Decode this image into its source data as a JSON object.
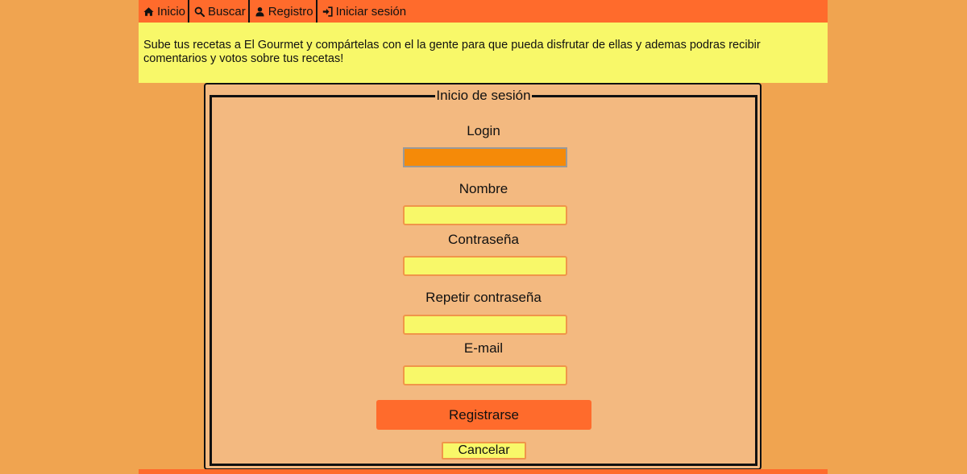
{
  "nav": {
    "items": [
      {
        "label": "Inicio",
        "icon": "home-icon"
      },
      {
        "label": "Buscar",
        "icon": "search-icon"
      },
      {
        "label": "Registro",
        "icon": "user-icon"
      },
      {
        "label": "Iniciar sesión",
        "icon": "sign-in-icon"
      }
    ]
  },
  "banner": {
    "text": "Sube tus recetas a El Gourmet y compártelas con el la gente para que pueda disfrutar de ellas y ademas podras recibir comentarios y votos sobre tus recetas!"
  },
  "form": {
    "legend": "Inicio de sesión",
    "fields": [
      {
        "label": "Login",
        "value": "",
        "focused": true
      },
      {
        "label": "Nombre",
        "value": ""
      },
      {
        "label": "Contraseña",
        "value": ""
      },
      {
        "label": "Repetir contraseña",
        "value": ""
      },
      {
        "label": "E-mail",
        "value": ""
      }
    ],
    "submit_label": "Registrarse",
    "cancel_label": "Cancelar"
  },
  "colors": {
    "page_bg": "#f0a450",
    "nav_bg": "#ff6b2c",
    "banner_bg": "#f8f869",
    "panel_bg": "#f3b980",
    "input_bg": "#f8f869",
    "focused_input_bg": "#f58a08"
  }
}
